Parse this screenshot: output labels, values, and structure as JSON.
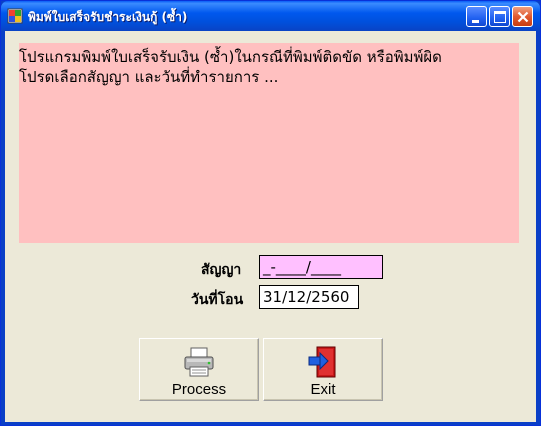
{
  "window": {
    "title": "พิมพ์ใบเสร็จรับชำระเงินกู้ (ซ้ำ)"
  },
  "message": {
    "line1": "โปรแกรมพิมพ์ใบเสร็จรับเงิน (ซ้ำ)ในกรณีที่พิมพ์ติดขัด หรือพิมพ์ผิด",
    "line2": "โปรดเลือกสัญญา และวันที่ทำรายการ ..."
  },
  "form": {
    "contract_label": "สัญญา",
    "contract_value": "_-____/____",
    "date_label": "วันที่โอน",
    "date_value": "31/12/2560"
  },
  "buttons": {
    "process_label": "Process",
    "exit_label": "Exit"
  },
  "colors": {
    "panel_bg": "#ffc0c0",
    "contract_field_bg": "#ffc0ff",
    "form_bg": "#ece9d8"
  }
}
